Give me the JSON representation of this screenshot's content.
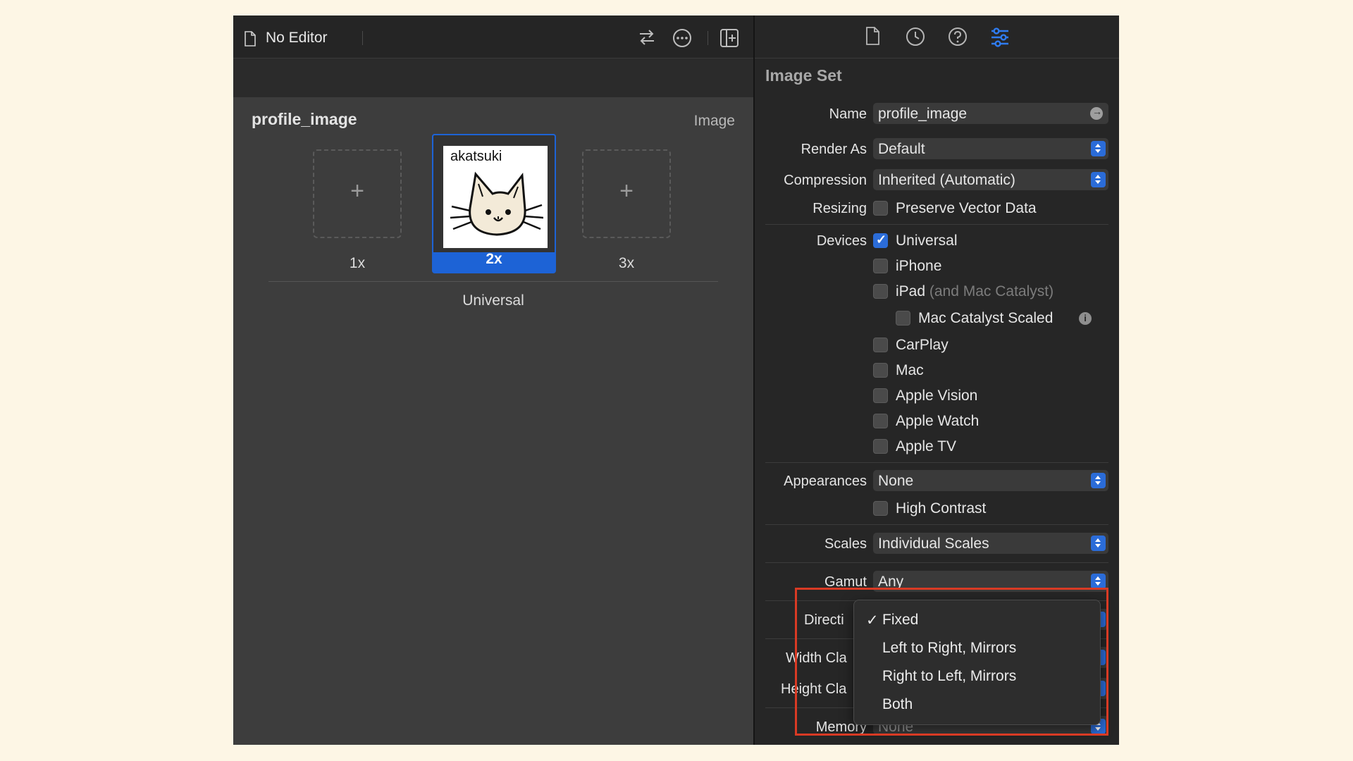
{
  "editor": {
    "title": "No Editor",
    "asset_name": "profile_image",
    "asset_type": "Image",
    "slots": [
      {
        "label": "1x",
        "filled": false
      },
      {
        "label": "2x",
        "filled": true,
        "thumbnail_text": "akatsuki",
        "icon": "cat-face-icon"
      },
      {
        "label": "3x",
        "filled": false
      }
    ],
    "group_label": "Universal",
    "add_symbol": "+"
  },
  "inspector": {
    "section_title": "Image Set",
    "name_label": "Name",
    "name_value": "profile_image",
    "render_as_label": "Render As",
    "render_as_value": "Default",
    "compression_label": "Compression",
    "compression_value": "Inherited (Automatic)",
    "resizing_label": "Resizing",
    "preserve_vector_label": "Preserve Vector Data",
    "devices_label": "Devices",
    "devices": [
      {
        "label": "Universal",
        "checked": true
      },
      {
        "label": "iPhone",
        "checked": false
      },
      {
        "label": "iPad",
        "suffix": "(and Mac Catalyst)",
        "checked": false
      },
      {
        "label": "Mac Catalyst Scaled",
        "checked": false,
        "indented": true
      },
      {
        "label": "CarPlay",
        "checked": false
      },
      {
        "label": "Mac",
        "checked": false
      },
      {
        "label": "Apple Vision",
        "checked": false
      },
      {
        "label": "Apple Watch",
        "checked": false
      },
      {
        "label": "Apple TV",
        "checked": false
      }
    ],
    "appearances_label": "Appearances",
    "appearances_value": "None",
    "high_contrast_label": "High Contrast",
    "scales_label": "Scales",
    "scales_value": "Individual Scales",
    "gamut_label": "Gamut",
    "gamut_value": "Any",
    "direction_label": "Directi",
    "width_class_label": "Width Cla",
    "height_class_label": "Height Cla",
    "memory_label": "Memory",
    "memory_value": "None"
  },
  "direction_menu": {
    "options": [
      "Fixed",
      "Left to Right, Mirrors",
      "Right to Left, Mirrors",
      "Both"
    ],
    "selected": "Fixed",
    "check_symbol": "✓"
  },
  "colors": {
    "accent": "#1d63d6",
    "highlight_box": "#d93a24",
    "background": "#fdf6e5"
  }
}
